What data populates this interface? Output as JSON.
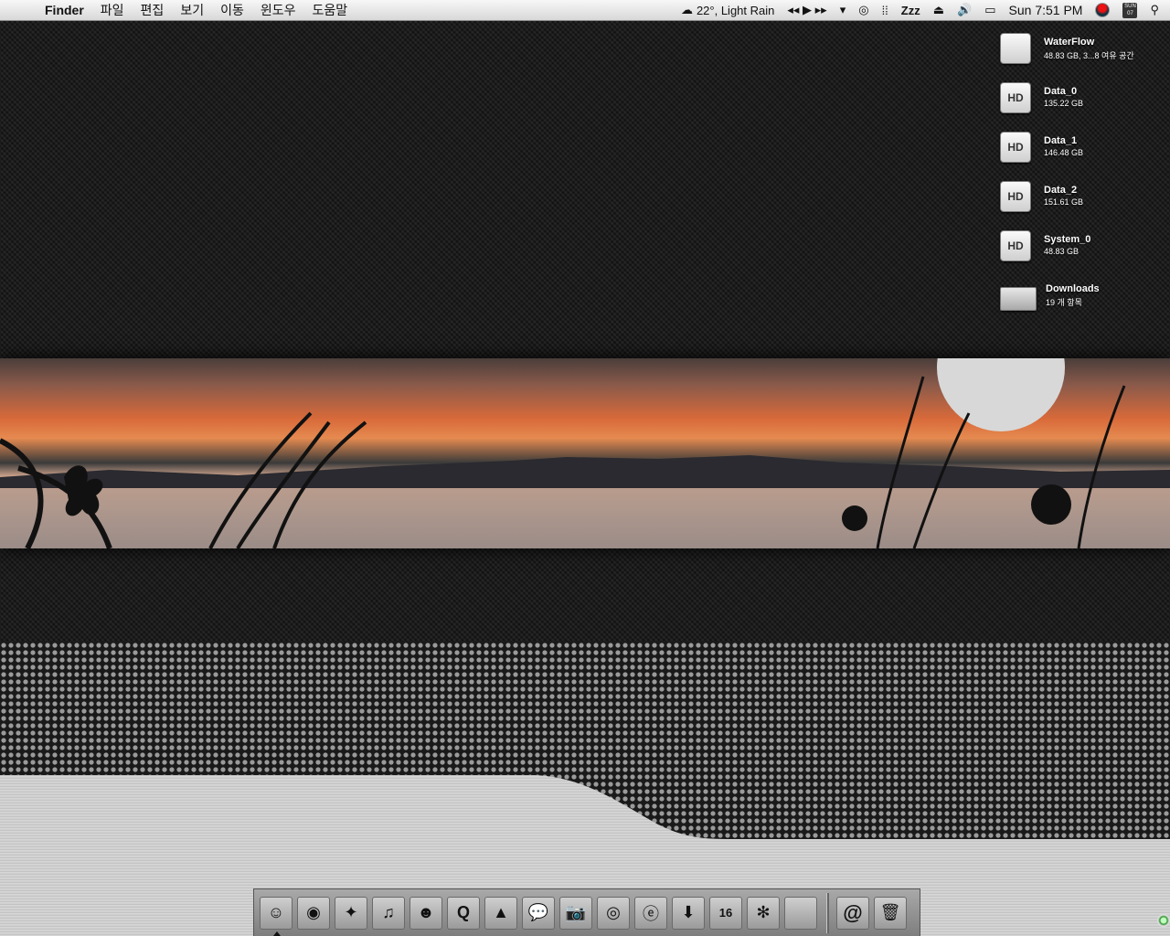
{
  "menubar": {
    "app_name": "Finder",
    "menus": [
      "파일",
      "편집",
      "보기",
      "이동",
      "윈도우",
      "도움말"
    ],
    "weather": "22°, Light Rain",
    "media_controls": "◂◂ ▶ ▸▸",
    "sleep": "Zzz",
    "clock": "Sun 7:51 PM",
    "calendar_day": "SUN",
    "calendar_date": "07"
  },
  "desktop": {
    "volumes": [
      {
        "name": "WaterFlow",
        "detail": "48.83 GB, 3...8 여유 공간",
        "badge": "",
        "icon": "apple-icon"
      },
      {
        "name": "Data_0",
        "detail": "135.22 GB",
        "badge": "HD",
        "icon": "hard-drive-icon"
      },
      {
        "name": "Data_1",
        "detail": "146.48 GB",
        "badge": "HD",
        "icon": "hard-drive-icon"
      },
      {
        "name": "Data_2",
        "detail": "151.61 GB",
        "badge": "HD",
        "icon": "hard-drive-icon"
      },
      {
        "name": "System_0",
        "detail": "48.83 GB",
        "badge": "HD",
        "icon": "hard-drive-icon"
      },
      {
        "name": "Downloads",
        "detail": "19 개 항목",
        "badge": "",
        "icon": "folder-icon"
      }
    ]
  },
  "dock": {
    "apps": [
      {
        "icon": "finder-icon",
        "glyph": "☺"
      },
      {
        "icon": "globe-icon",
        "glyph": "◉"
      },
      {
        "icon": "preview-icon",
        "glyph": "✦"
      },
      {
        "icon": "itunes-icon",
        "glyph": "♫"
      },
      {
        "icon": "messenger-icon",
        "glyph": "☻"
      },
      {
        "icon": "quicktime-icon",
        "glyph": "Q"
      },
      {
        "icon": "vlc-icon",
        "glyph": "▲"
      },
      {
        "icon": "chat-icon",
        "glyph": "💬"
      },
      {
        "icon": "camera-icon",
        "glyph": "📷"
      },
      {
        "icon": "eye-icon",
        "glyph": "◎"
      },
      {
        "icon": "script-icon",
        "glyph": "ⓔ"
      },
      {
        "icon": "download-icon",
        "glyph": "⬇"
      },
      {
        "icon": "calendar-icon",
        "glyph": "16"
      },
      {
        "icon": "asterisk-icon",
        "glyph": "✻"
      },
      {
        "icon": "apple-icon",
        "glyph": ""
      }
    ],
    "extras": [
      {
        "icon": "mail-icon",
        "glyph": "@"
      },
      {
        "icon": "trash-icon",
        "glyph": "🗑"
      }
    ],
    "colors": {
      "bar": "#9a9a9a",
      "separator": "#666666"
    }
  },
  "colors": {
    "menubar": "#e6e6e6",
    "carbon": "#1b1b1b",
    "sunset": "#e0703a",
    "steel": "#cccccc"
  }
}
